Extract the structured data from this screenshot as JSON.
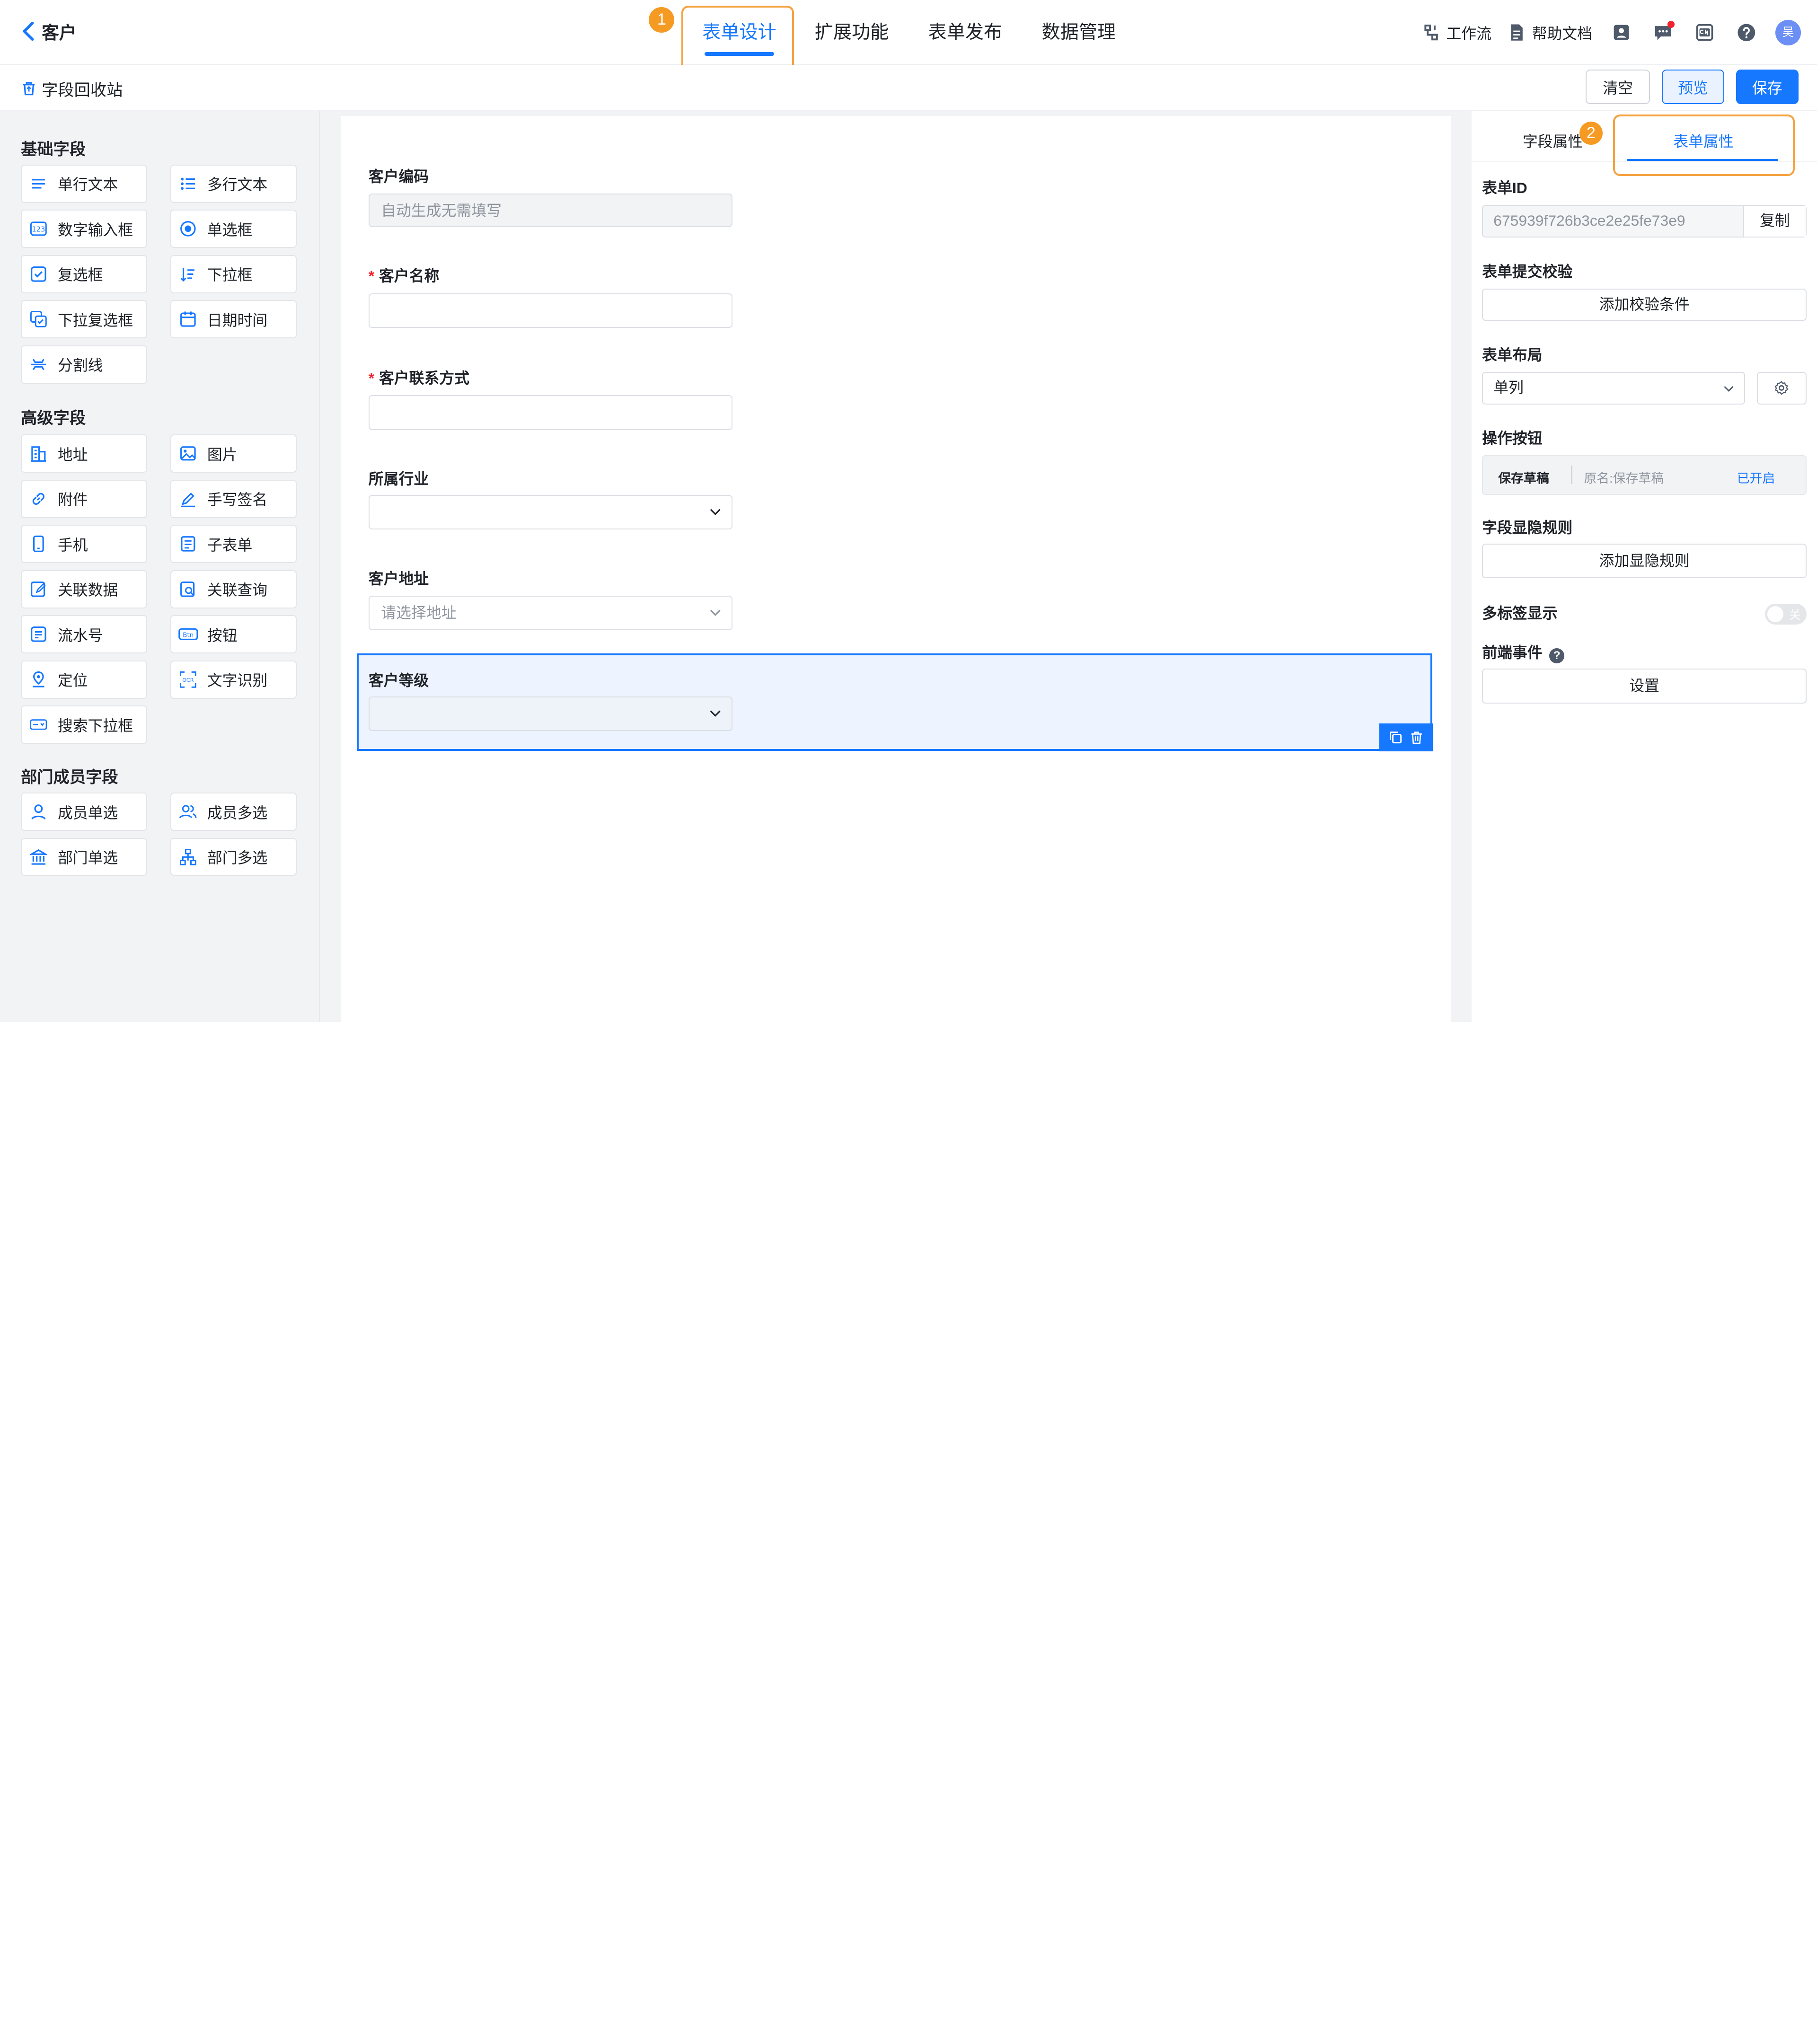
{
  "header": {
    "back_label": "客户",
    "nav": [
      "表单设计",
      "扩展功能",
      "表单发布",
      "数据管理"
    ],
    "tools": {
      "workflow": "工作流",
      "help_docs": "帮助文档"
    },
    "avatar_text": "吴",
    "badges": [
      "1",
      "2"
    ]
  },
  "subbar": {
    "recycle": "字段回收站",
    "clear": "清空",
    "preview": "预览",
    "save": "保存"
  },
  "groups": {
    "basic": {
      "title": "基础字段",
      "items": [
        "单行文本",
        "多行文本",
        "数字输入框",
        "单选框",
        "复选框",
        "下拉框",
        "下拉复选框",
        "日期时间",
        "分割线"
      ]
    },
    "advanced": {
      "title": "高级字段",
      "items": [
        "地址",
        "图片",
        "附件",
        "手写签名",
        "手机",
        "子表单",
        "关联数据",
        "关联查询",
        "流水号",
        "按钮",
        "定位",
        "文字识别",
        "搜索下拉框"
      ]
    },
    "dept": {
      "title": "部门成员字段",
      "items": [
        "成员单选",
        "成员多选",
        "部门单选",
        "部门多选"
      ]
    }
  },
  "form": {
    "code": {
      "label": "客户编码",
      "placeholder": "自动生成无需填写"
    },
    "name": {
      "label": "客户名称",
      "required": "*"
    },
    "contact": {
      "label": "客户联系方式",
      "required": "*"
    },
    "industry": {
      "label": "所属行业"
    },
    "address": {
      "label": "客户地址",
      "placeholder": "请选择地址"
    },
    "level": {
      "label": "客户等级"
    }
  },
  "props": {
    "tabs": [
      "字段属性",
      "表单属性"
    ],
    "form_id_label": "表单ID",
    "form_id": "675939f726b3ce2e25fe73e9",
    "copy": "复制",
    "validate_label": "表单提交校验",
    "add_validate": "添加校验条件",
    "layout_label": "表单布局",
    "layout_value": "单列",
    "op_label": "操作按钮",
    "op_name": "保存草稿",
    "op_orig": "原名:保存草稿",
    "op_status": "已开启",
    "visibility_label": "字段显隐规则",
    "add_visibility": "添加显隐规则",
    "multitab_label": "多标签显示",
    "toggle_text": "关",
    "events_label": "前端事件",
    "events_help": "?",
    "events_btn": "设置"
  },
  "colors": {
    "accent": "#1677ff",
    "highlight": "#f5a241",
    "badge": "#f59a23"
  }
}
